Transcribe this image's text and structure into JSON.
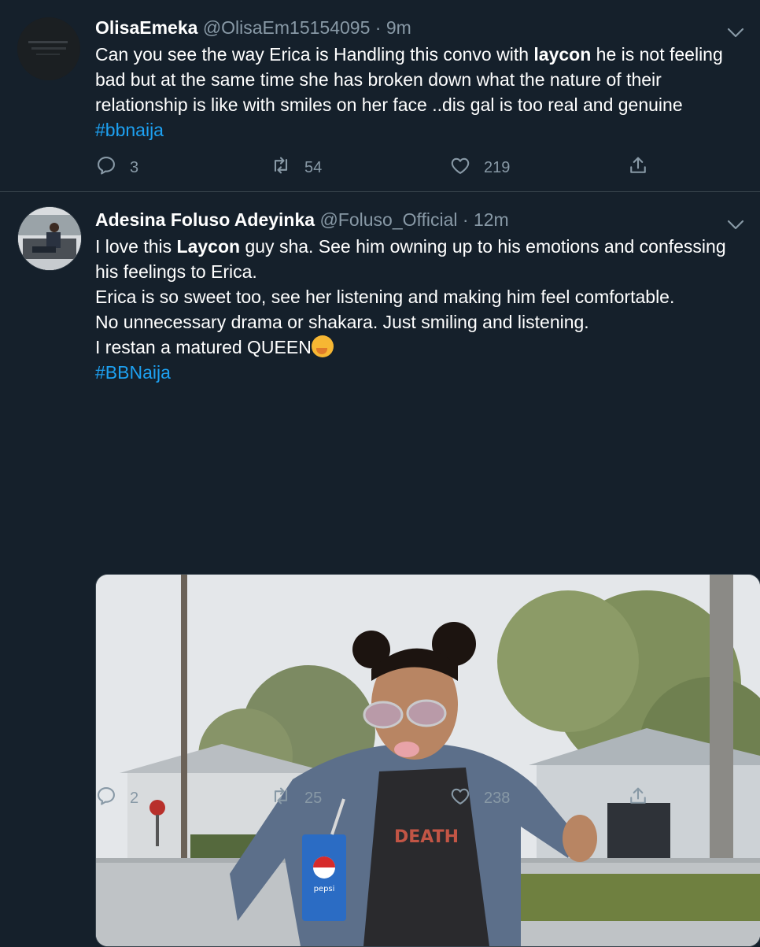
{
  "tweets": [
    {
      "name": "OlisaEmeka",
      "handle": "@OlisaEm15154095",
      "time": "9m",
      "body": {
        "t1": "Can you see the way Erica is Handling this convo with ",
        "b1": "laycon",
        "t2": " he is not feeling bad but at the same time she has broken down  what the nature of their relationship is like with smiles on her face ..dis gal is too real and genuine ",
        "hashtag": "#bbnaija"
      },
      "replies": "3",
      "retweets": "54",
      "likes": "219"
    },
    {
      "name": "Adesina Foluso Adeyinka",
      "handle": "@Foluso_Official",
      "time": "12m",
      "body": {
        "l1a": "I love this ",
        "l1b": "Laycon",
        "l1c": " guy sha. See him owning up to his emotions and confessing his feelings to Erica.",
        "l2": "Erica is so sweet too, see her listening and making him feel comfortable.",
        "l3": "No unnecessary drama or shakara. Just smiling and listening.",
        "l4": "I restan a matured QUEEN",
        "hashtag": "#BBNaija"
      },
      "media": {
        "cup_text": "pepsi",
        "shirt_text": "DEATH"
      },
      "replies": "2",
      "retweets": "25",
      "likes": "238"
    }
  ],
  "icons": {
    "reply": "reply-icon",
    "retweet": "retweet-icon",
    "like": "heart-icon",
    "share": "share-icon",
    "more": "chevron-down-icon"
  },
  "colors": {
    "background": "#15202b",
    "secondary_text": "#8899a6",
    "link": "#1da1f2",
    "divider": "#38444d"
  }
}
